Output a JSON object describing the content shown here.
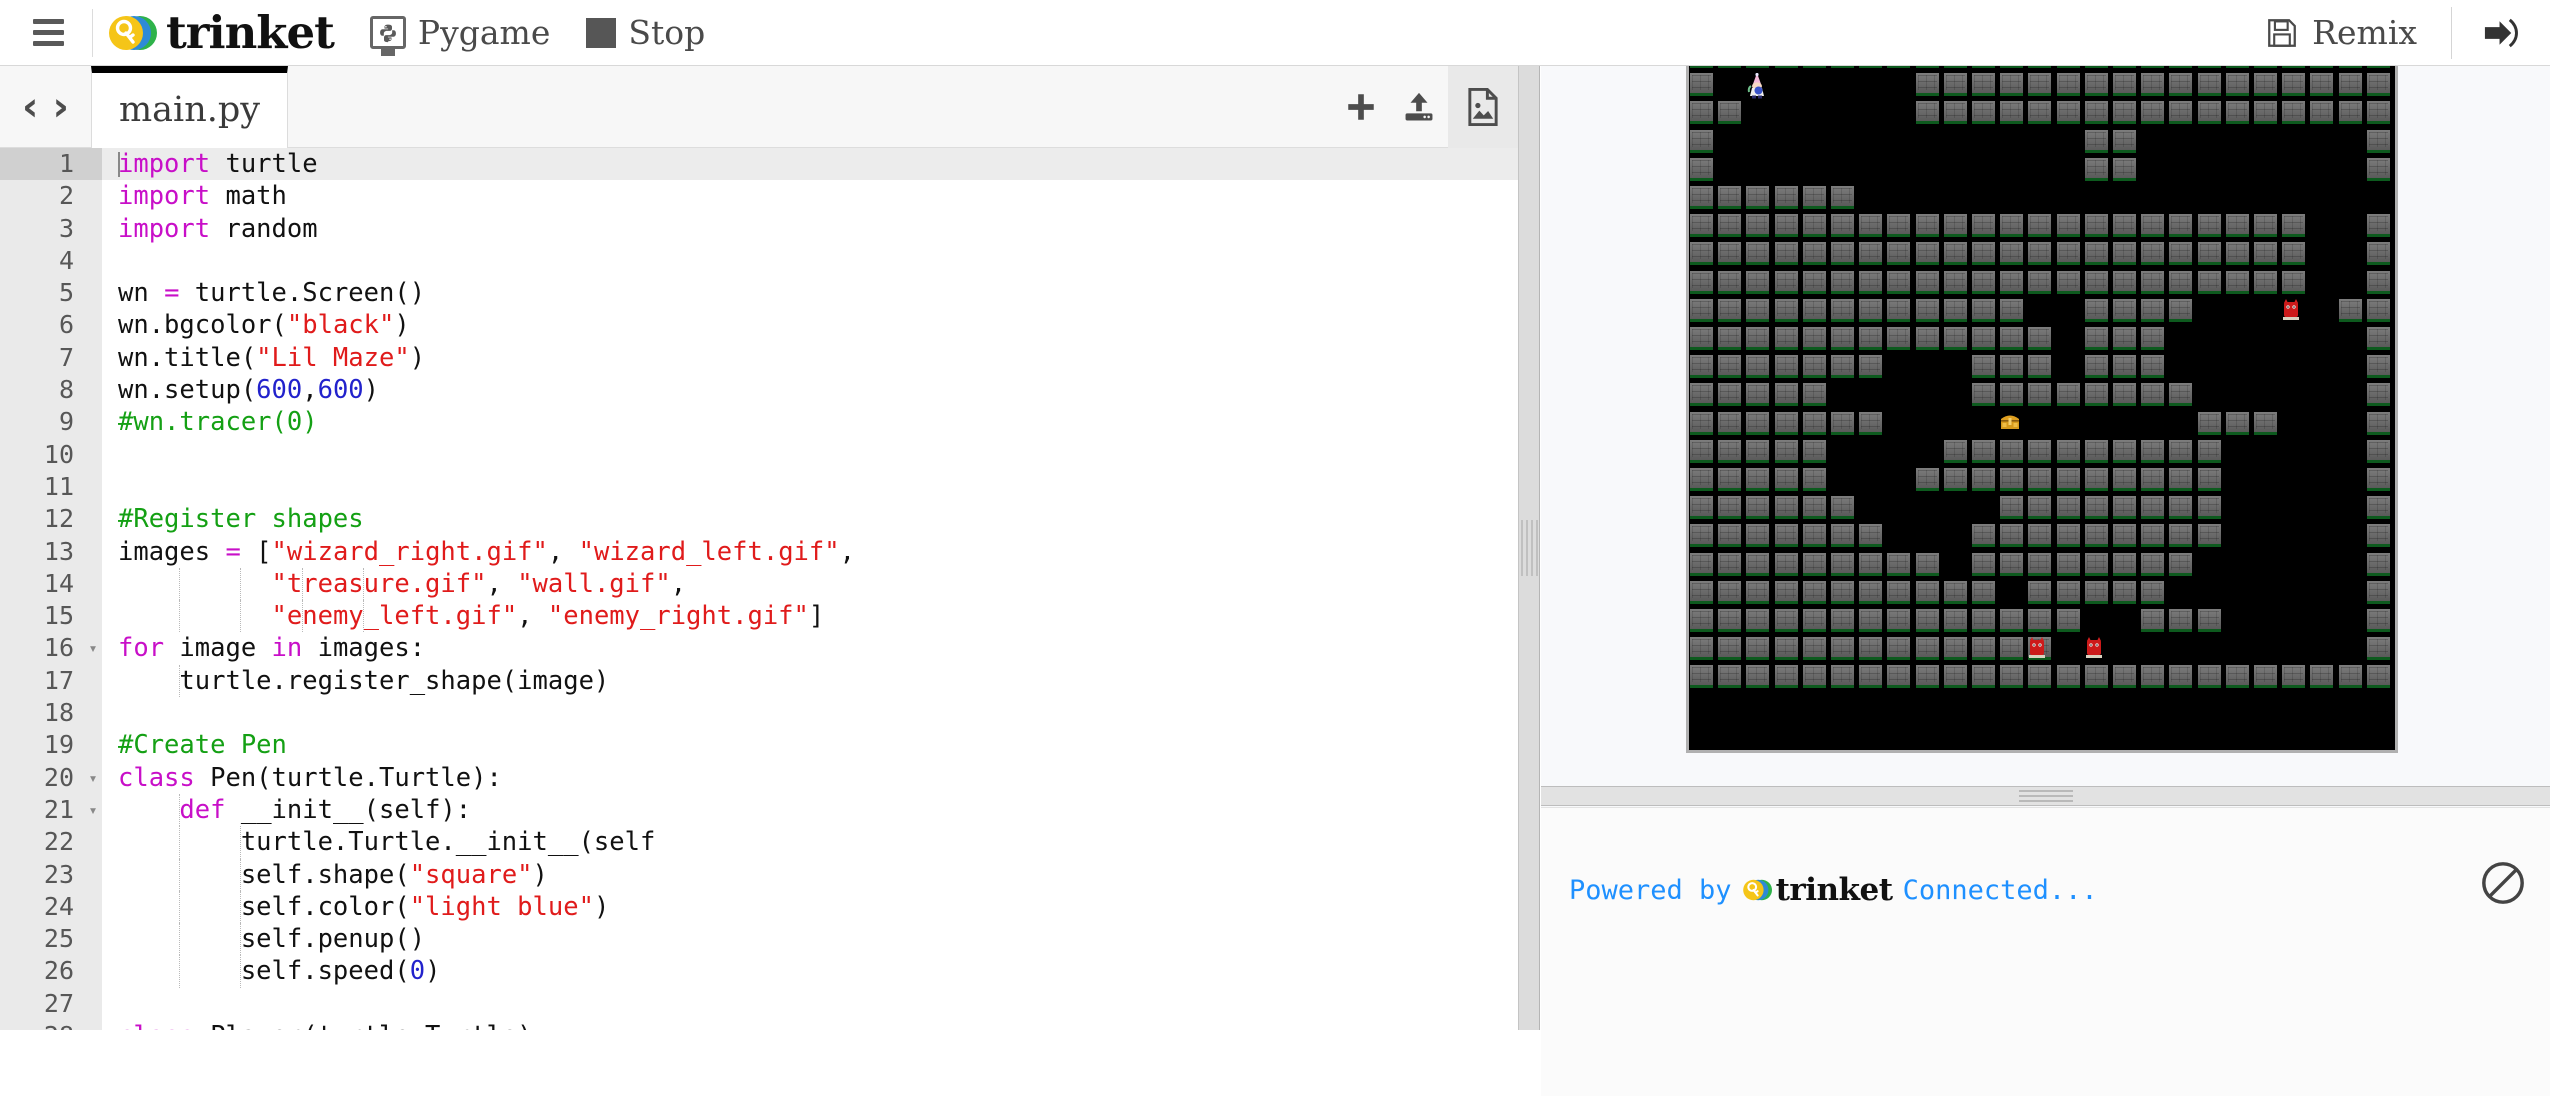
{
  "header": {
    "menu_icon": "hamburger-menu-icon",
    "brand": "trinket",
    "brand_logo_icon": "trinket-key-logo-icon",
    "language": {
      "label": "Pygame",
      "icon": "python-monitor-icon"
    },
    "stop": {
      "label": "Stop",
      "icon": "stop-square-icon"
    },
    "remix": {
      "label": "Remix",
      "icon": "floppy-disk-save-icon"
    },
    "login": {
      "icon": "sign-in-arrow-icon"
    }
  },
  "editor": {
    "nav": {
      "prev": "‹",
      "next": "›"
    },
    "tab": {
      "name": "main.py"
    },
    "tools": [
      {
        "name": "add-file-button",
        "icon": "plus-icon",
        "active": false
      },
      {
        "name": "upload-file-button",
        "icon": "upload-icon",
        "active": false
      },
      {
        "name": "image-file-button",
        "icon": "image-file-icon",
        "active": true
      }
    ],
    "active_line": 1,
    "lines": [
      {
        "n": 1,
        "fold": false,
        "guides": 0,
        "tokens": [
          [
            "kw",
            "import"
          ],
          [
            "txt",
            " turtle"
          ]
        ]
      },
      {
        "n": 2,
        "fold": false,
        "guides": 0,
        "tokens": [
          [
            "kw",
            "import"
          ],
          [
            "txt",
            " math"
          ]
        ]
      },
      {
        "n": 3,
        "fold": false,
        "guides": 0,
        "tokens": [
          [
            "kw",
            "import"
          ],
          [
            "txt",
            " random"
          ]
        ]
      },
      {
        "n": 4,
        "fold": false,
        "guides": 0,
        "tokens": []
      },
      {
        "n": 5,
        "fold": false,
        "guides": 0,
        "tokens": [
          [
            "txt",
            "wn "
          ],
          [
            "op",
            "="
          ],
          [
            "txt",
            " turtle.Screen()"
          ]
        ]
      },
      {
        "n": 6,
        "fold": false,
        "guides": 0,
        "tokens": [
          [
            "txt",
            "wn.bgcolor("
          ],
          [
            "str",
            "\"black\""
          ],
          [
            "txt",
            ")"
          ]
        ]
      },
      {
        "n": 7,
        "fold": false,
        "guides": 0,
        "tokens": [
          [
            "txt",
            "wn.title("
          ],
          [
            "str",
            "\"Lil Maze\""
          ],
          [
            "txt",
            ")"
          ]
        ]
      },
      {
        "n": 8,
        "fold": false,
        "guides": 0,
        "tokens": [
          [
            "txt",
            "wn.setup("
          ],
          [
            "num",
            "600"
          ],
          [
            "txt",
            ","
          ],
          [
            "num",
            "600"
          ],
          [
            "txt",
            ")"
          ]
        ]
      },
      {
        "n": 9,
        "fold": false,
        "guides": 0,
        "tokens": [
          [
            "cmt",
            "#wn.tracer(0)"
          ]
        ]
      },
      {
        "n": 10,
        "fold": false,
        "guides": 0,
        "tokens": []
      },
      {
        "n": 11,
        "fold": false,
        "guides": 0,
        "tokens": []
      },
      {
        "n": 12,
        "fold": false,
        "guides": 0,
        "tokens": [
          [
            "cmt",
            "#Register shapes"
          ]
        ]
      },
      {
        "n": 13,
        "fold": false,
        "guides": 0,
        "tokens": [
          [
            "txt",
            "images "
          ],
          [
            "op",
            "="
          ],
          [
            "txt",
            " ["
          ],
          [
            "str",
            "\"wizard_right.gif\""
          ],
          [
            "txt",
            ", "
          ],
          [
            "str",
            "\"wizard_left.gif\""
          ],
          [
            "txt",
            ","
          ]
        ]
      },
      {
        "n": 14,
        "fold": false,
        "guides": 4,
        "tokens": [
          [
            "txt",
            "          "
          ],
          [
            "str",
            "\"treasure.gif\""
          ],
          [
            "txt",
            ", "
          ],
          [
            "str",
            "\"wall.gif\""
          ],
          [
            "txt",
            ","
          ]
        ]
      },
      {
        "n": 15,
        "fold": false,
        "guides": 4,
        "tokens": [
          [
            "txt",
            "          "
          ],
          [
            "str",
            "\"enemy_left.gif\""
          ],
          [
            "txt",
            ", "
          ],
          [
            "str",
            "\"enemy_right.gif\""
          ],
          [
            "txt",
            "]"
          ]
        ]
      },
      {
        "n": 16,
        "fold": true,
        "guides": 0,
        "tokens": [
          [
            "kw",
            "for"
          ],
          [
            "txt",
            " image "
          ],
          [
            "kw",
            "in"
          ],
          [
            "txt",
            " images:"
          ]
        ]
      },
      {
        "n": 17,
        "fold": false,
        "guides": 1,
        "tokens": [
          [
            "txt",
            "    turtle.register_shape(image)"
          ]
        ]
      },
      {
        "n": 18,
        "fold": false,
        "guides": 0,
        "tokens": []
      },
      {
        "n": 19,
        "fold": false,
        "guides": 0,
        "tokens": [
          [
            "cmt",
            "#Create Pen"
          ]
        ]
      },
      {
        "n": 20,
        "fold": true,
        "guides": 0,
        "tokens": [
          [
            "kw",
            "class"
          ],
          [
            "txt",
            " Pen(turtle.Turtle):"
          ]
        ]
      },
      {
        "n": 21,
        "fold": true,
        "guides": 1,
        "tokens": [
          [
            "txt",
            "    "
          ],
          [
            "kw",
            "def"
          ],
          [
            "txt",
            " __init__(self):"
          ]
        ]
      },
      {
        "n": 22,
        "fold": false,
        "guides": 2,
        "tokens": [
          [
            "txt",
            "        turtle.Turtle.__init__(self"
          ]
        ]
      },
      {
        "n": 23,
        "fold": false,
        "guides": 2,
        "tokens": [
          [
            "txt",
            "        self.shape("
          ],
          [
            "str",
            "\"square\""
          ],
          [
            "txt",
            ")"
          ]
        ]
      },
      {
        "n": 24,
        "fold": false,
        "guides": 2,
        "tokens": [
          [
            "txt",
            "        self.color("
          ],
          [
            "str",
            "\"light blue\""
          ],
          [
            "txt",
            ")"
          ]
        ]
      },
      {
        "n": 25,
        "fold": false,
        "guides": 2,
        "tokens": [
          [
            "txt",
            "        self.penup()"
          ]
        ]
      },
      {
        "n": 26,
        "fold": false,
        "guides": 2,
        "tokens": [
          [
            "txt",
            "        self.speed("
          ],
          [
            "num",
            "0"
          ],
          [
            "txt",
            ")"
          ]
        ]
      },
      {
        "n": 27,
        "fold": false,
        "guides": 0,
        "tokens": []
      },
      {
        "n": 28,
        "fold": true,
        "guides": 0,
        "tokens": [
          [
            "kw",
            "class"
          ],
          [
            "txt",
            " Player(turtle.Turtle):"
          ]
        ]
      }
    ]
  },
  "output": {
    "canvas": {
      "title": "Lil Maze",
      "background": "#000000",
      "wall_color": "#6e6e6e",
      "wall_edge_color": "#0d5a1e",
      "cols": 25,
      "rows": 25,
      "sprites": [
        {
          "type": "wizard",
          "name": "player-wizard-sprite",
          "col": 2,
          "row": 1
        },
        {
          "type": "treasure",
          "name": "treasure-chest-sprite",
          "col": 11,
          "row": 13
        },
        {
          "type": "enemy",
          "name": "enemy-sprite",
          "col": 21,
          "row": 9
        },
        {
          "type": "enemy",
          "name": "enemy-sprite",
          "col": 12,
          "row": 21
        },
        {
          "type": "enemy",
          "name": "enemy-sprite",
          "col": 14,
          "row": 21
        }
      ],
      "grid": [
        "XXXXXXXXXXXXXXXXXXXXXXXXX",
        "X.......XXXXXXXXXXXXXXXXX",
        "XX......XXXXXXXXXXXXXXXXX",
        "X.............XX........X",
        "X.............XX........X",
        "XXXXXX...................",
        "XXXXXXXXXXXXXXXXXXXXXX..X",
        "XXXXXXXXXXXXXXXXXXXXXX..X",
        "XXXXXXXXXXXXXXXXXXXXXX..X",
        "XXXXXXXXXXXX..XXXX.....XX",
        "XXXXXXXXXXXXX.XXX.......X",
        "XXXXXXX...XXX.XXX.......X",
        "XXXXX.....XXXXXXXX......X",
        "XXXXXXX...........XXX...X",
        "XXXXX....XXXXXXXXXX.....X",
        "XXXXX...XXXXXXXXXXX.....X",
        "XXXXXX.....XXXXXXXX.....X",
        "XXXXXXX...XXXXXXXXX.....X",
        "XXXXXXXXX.XXXXXXXX......X",
        "XXXXXXXXXXX.XXXXX.......X",
        "XXXXXXXXXXXXXX..XXX.....X",
        "XXXXXXXXXXXXX...........X",
        "XXXXXXXXXXXXXXXXXXXXXXXXX",
        ".........................",
        "........................."
      ]
    },
    "console": {
      "prefix": "Powered by",
      "brand": "trinket",
      "status": "Connected...",
      "clear_icon": "no-entry-clear-console-icon",
      "text_color": "#1e90ff"
    }
  }
}
